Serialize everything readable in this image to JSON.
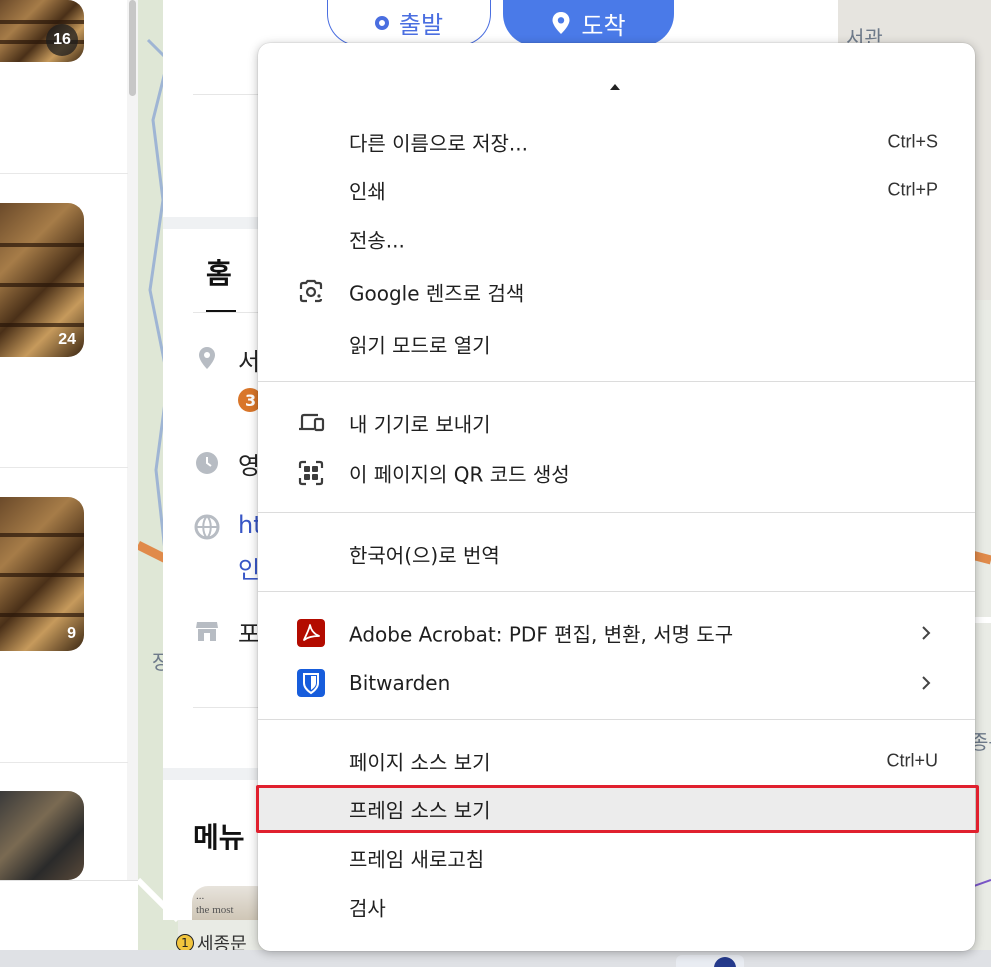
{
  "results": {
    "photo_counts": [
      "16",
      "24",
      "9"
    ]
  },
  "panel": {
    "directions": {
      "start_label": "출발",
      "dest_label": "도착"
    },
    "tab_home": "홈",
    "address_snippet": "서",
    "badge_snippet": "3",
    "hours_snippet": "영",
    "url_snippet_1": "ht",
    "url_snippet_2": "인",
    "store_snippet": "포",
    "menu_heading": "메뉴"
  },
  "map": {
    "labels": {
      "top_right": "서관",
      "right_edge": "종문",
      "left_edge": "장"
    },
    "station": {
      "line_number": "1",
      "name": "세종문"
    }
  },
  "context_menu": {
    "items": [
      {
        "id": "save-as",
        "label": "다른 이름으로 저장...",
        "shortcut": "Ctrl+S"
      },
      {
        "id": "print",
        "label": "인쇄",
        "shortcut": "Ctrl+P"
      },
      {
        "id": "cast",
        "label": "전송..."
      },
      {
        "id": "google-lens",
        "label": "Google 렌즈로 검색",
        "icon": "lens-icon"
      },
      {
        "id": "reading-mode",
        "label": "읽기 모드로 열기"
      },
      {
        "id": "send-to-device",
        "label": "내 기기로 보내기",
        "icon": "devices-icon"
      },
      {
        "id": "qr-code",
        "label": "이 페이지의 QR 코드 생성",
        "icon": "qr-code-icon"
      },
      {
        "id": "translate",
        "label": "한국어(으)로 번역"
      },
      {
        "id": "adobe-acrobat",
        "label": "Adobe Acrobat: PDF 편집, 변환, 서명 도구",
        "icon": "acrobat-icon",
        "submenu": true
      },
      {
        "id": "bitwarden",
        "label": "Bitwarden",
        "icon": "bitwarden-icon",
        "submenu": true
      },
      {
        "id": "view-page-source",
        "label": "페이지 소스 보기",
        "shortcut": "Ctrl+U"
      },
      {
        "id": "view-frame-source",
        "label": "프레임 소스 보기",
        "highlighted": true
      },
      {
        "id": "reload-frame",
        "label": "프레임 새로고침"
      },
      {
        "id": "inspect",
        "label": "검사"
      }
    ]
  },
  "colors": {
    "accent_blue": "#4a7ae8",
    "highlight_red": "#e0202e",
    "acrobat_red": "#b30b00",
    "bitwarden_blue": "#175ddc"
  }
}
